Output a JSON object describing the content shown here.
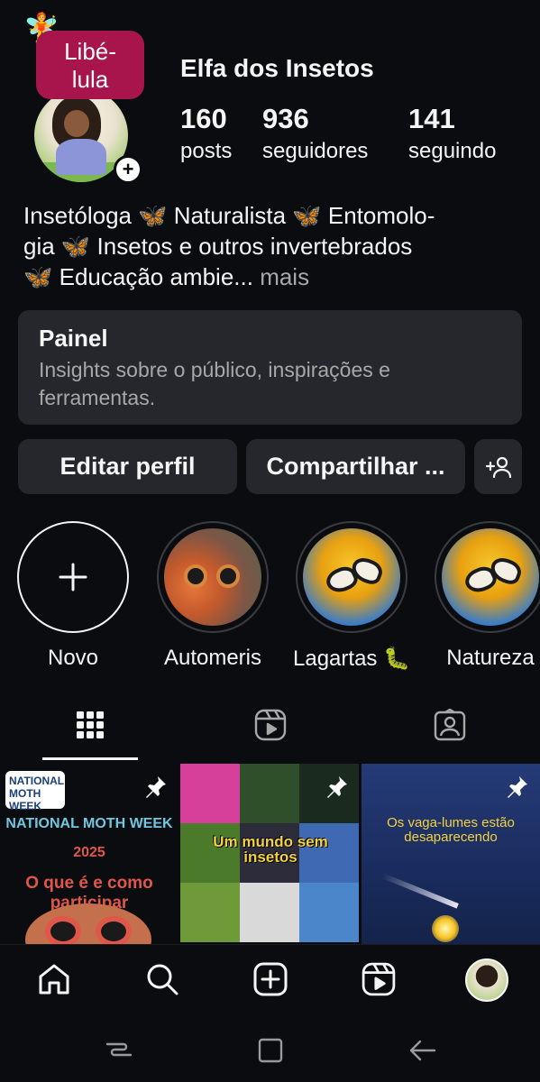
{
  "profile": {
    "username": "Elfa dos Insetos",
    "note": "Libé-\nlula",
    "stats": [
      {
        "value": "160",
        "label": "posts"
      },
      {
        "value": "936",
        "label": "seguidores"
      },
      {
        "value": "141",
        "label": "seguindo"
      }
    ],
    "bio_line1": "Insetóloga 🦋 Naturalista 🦋 Entomolo-",
    "bio_line2": "gia 🦋 Insetos e outros invertebrados",
    "bio_line3": "🦋 Educação ambie...",
    "bio_more": "mais"
  },
  "dashboard": {
    "title": "Painel",
    "subtitle": "Insights sobre o público, inspirações e ferramentas."
  },
  "actions": {
    "edit": "Editar perfil",
    "share": "Compartilhar ..."
  },
  "highlights": [
    {
      "label": "Novo",
      "icon": "plus-icon"
    },
    {
      "label": "Automeris"
    },
    {
      "label": "Lagartas 🐛"
    },
    {
      "label": "Natureza"
    }
  ],
  "tabs": [
    {
      "name": "grid",
      "icon": "grid-icon",
      "active": true
    },
    {
      "name": "reels",
      "icon": "reels-icon"
    },
    {
      "name": "tagged",
      "icon": "tagged-icon"
    }
  ],
  "posts": [
    {
      "pinned": true,
      "badge": "NATIONAL MOTH WEEK",
      "line1": "NATIONAL MOTH WEEK",
      "line2": "2025",
      "line3": "O que é e como participar"
    },
    {
      "pinned": true,
      "title": "Um mundo sem insetos"
    },
    {
      "pinned": true,
      "title": "Os vaga-lumes estão desaparecendo"
    }
  ],
  "colors": {
    "background": "#0b0c10",
    "card": "#25272c",
    "note": "#a8154d",
    "muted": "#a8a8a8"
  }
}
